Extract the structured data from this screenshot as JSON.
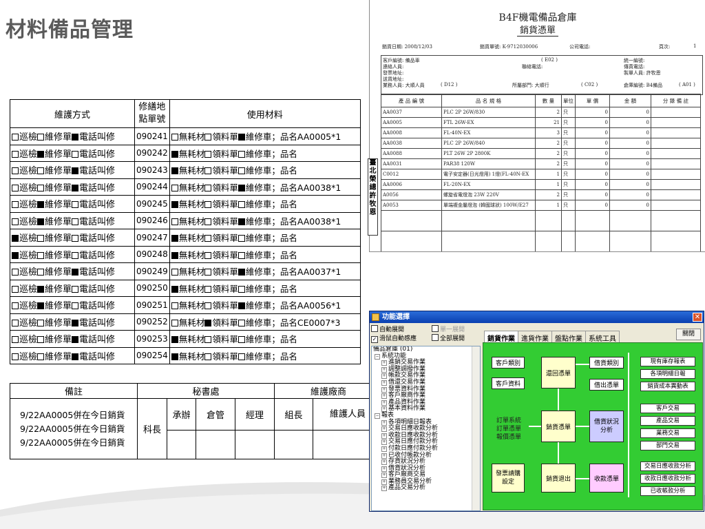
{
  "page": {
    "title": "材料備品管理"
  },
  "maintenance_table": {
    "headers": {
      "method": "維護方式",
      "order_no": "修繕地點單號",
      "materials": "使用材料"
    },
    "rows": [
      {
        "m": [
          0,
          0,
          1
        ],
        "no": "090241",
        "mat": [
          0,
          0,
          1
        ],
        "item": "品名AA0005*1"
      },
      {
        "m": [
          0,
          1,
          0
        ],
        "no": "090242",
        "mat": [
          1,
          0,
          0
        ],
        "item": "品名"
      },
      {
        "m": [
          0,
          0,
          1
        ],
        "no": "090243",
        "mat": [
          1,
          0,
          0
        ],
        "item": "品名"
      },
      {
        "m": [
          0,
          0,
          1
        ],
        "no": "090244",
        "mat": [
          0,
          0,
          1
        ],
        "item": "品名AA0038*1"
      },
      {
        "m": [
          0,
          1,
          0
        ],
        "no": "090245",
        "mat": [
          1,
          0,
          0
        ],
        "item": "品名"
      },
      {
        "m": [
          0,
          1,
          0
        ],
        "no": "090246",
        "mat": [
          0,
          0,
          1
        ],
        "item": "品名AA0038*1"
      },
      {
        "m": [
          1,
          0,
          0
        ],
        "no": "090247",
        "mat": [
          1,
          0,
          0
        ],
        "item": "品名"
      },
      {
        "m": [
          1,
          0,
          0
        ],
        "no": "090248",
        "mat": [
          1,
          0,
          0
        ],
        "item": "品名"
      },
      {
        "m": [
          0,
          0,
          1
        ],
        "no": "090249",
        "mat": [
          0,
          0,
          1
        ],
        "item": "品名AA0037*1"
      },
      {
        "m": [
          0,
          1,
          0
        ],
        "no": "090250",
        "mat": [
          1,
          0,
          0
        ],
        "item": "品名"
      },
      {
        "m": [
          0,
          1,
          0
        ],
        "no": "090251",
        "mat": [
          0,
          0,
          1
        ],
        "item": "品名AA0056*1"
      },
      {
        "m": [
          0,
          0,
          1
        ],
        "no": "090252",
        "mat": [
          0,
          1,
          0
        ],
        "item": "品名CE0007*3"
      },
      {
        "m": [
          0,
          0,
          1
        ],
        "no": "090253",
        "mat": [
          1,
          0,
          0
        ],
        "item": "品名"
      },
      {
        "m": [
          0,
          0,
          1
        ],
        "no": "090254",
        "mat": [
          1,
          0,
          0
        ],
        "item": "品名"
      }
    ],
    "method_labels": [
      "巡檢",
      "維修單",
      "電話叫修"
    ],
    "material_labels": [
      "無耗材",
      "領料單",
      "維修車；"
    ]
  },
  "footer_table": {
    "remark_header": "備註",
    "secretariat": "秘書處",
    "vendor": "維護廠商",
    "roles": [
      "科長",
      "承辦",
      "倉管",
      "經理",
      "組長",
      "維護人員"
    ],
    "remarks": [
      "9/22AA0005併在今日銷貨",
      "9/22AA0005併在今日銷貨",
      "9/22AA0005併在今日銷貨"
    ]
  },
  "invoice": {
    "title": "B4F機電備品倉庫",
    "subtitle": "銷貨憑單",
    "date": "銷貨日期: 2008/12/03",
    "no": "銷貨單號: K-9712030006",
    "phone": "公司電話:",
    "page": "頁次:",
    "page_num": "1",
    "customer": "客戶編號: 備品車",
    "customer_code": "( E02 )",
    "contact": "連絡人員:",
    "contact_phone": "聯絡電話:",
    "invoice_addr": "發票地址:",
    "ship_addr": "送貨地址:",
    "sales": "業務人員: 大順人員",
    "sales_code": "( D12 )",
    "dept": "所屬部門: 大順行",
    "dept_code": "( C02 )",
    "tax_id": "統一編號:",
    "fax": "傳真電話:",
    "maker": "製單人員: 許牧恩",
    "warehouse": "倉庫編號: B4備品",
    "warehouse_code": "( A01 )",
    "col_headers": [
      "產 品 編 號",
      "品 名 規 格",
      "數 量",
      "單位",
      "單 價",
      "金 額",
      "分 錄 備 註"
    ],
    "items": [
      {
        "code": "AA0037",
        "name": "PLC 2P 26W/830",
        "qty": "2",
        "unit": "只",
        "price": "0",
        "amount": "0"
      },
      {
        "code": "AA0005",
        "name": "FTL 26W-EX",
        "qty": "21",
        "unit": "只",
        "price": "0",
        "amount": "0"
      },
      {
        "code": "AA0008",
        "name": "FL-40N-EX",
        "qty": "3",
        "unit": "只",
        "price": "0",
        "amount": "0"
      },
      {
        "code": "AA0038",
        "name": "PLC 2P 26W/840",
        "qty": "2",
        "unit": "只",
        "price": "0",
        "amount": "0"
      },
      {
        "code": "AA0088",
        "name": "PLT 26W 2P 2800K",
        "qty": "2",
        "unit": "只",
        "price": "0",
        "amount": "0"
      },
      {
        "code": "AA0031",
        "name": "PAR38 120W",
        "qty": "2",
        "unit": "只",
        "price": "0",
        "amount": "0"
      },
      {
        "code": "C0012",
        "name": "電子安定器(日光燈用) 1燈(FL-40N-EX",
        "qty": "1",
        "unit": "只",
        "price": "0",
        "amount": "0"
      },
      {
        "code": "AA0006",
        "name": "FL-20N-EX",
        "qty": "1",
        "unit": "只",
        "price": "0",
        "amount": "0"
      },
      {
        "code": "A0056",
        "name": "螺旋省電燈泡 23W 220V",
        "qty": "2",
        "unit": "只",
        "price": "0",
        "amount": "0"
      },
      {
        "code": "A0053",
        "name": "單端複金屬燈泡 (韓國球狀) 100W/E27",
        "qty": "1",
        "unit": "只",
        "price": "0",
        "amount": "0"
      }
    ],
    "stamp": "臺北榮總許牧恩"
  },
  "app": {
    "title": "功能選擇",
    "opts": {
      "auto_expand": "自動展開",
      "single_expand": "單一展開",
      "mouse_sense": "滑鼠自動感應",
      "all_expand": "全部展開"
    },
    "tabs": [
      "銷貨作業",
      "進貨作業",
      "盤點作業",
      "系統工具"
    ],
    "close": "關閉",
    "tree": [
      {
        "t": "備品倉庫 (01)",
        "lvl": 0,
        "pm": ""
      },
      {
        "t": "系統功能",
        "lvl": 1,
        "pm": "−"
      },
      {
        "t": "進銷交易作業",
        "lvl": 2,
        "pm": "+"
      },
      {
        "t": "調整調撥作業",
        "lvl": 2,
        "pm": "+"
      },
      {
        "t": "帳款交易作業",
        "lvl": 2,
        "pm": "+"
      },
      {
        "t": "借還交易作業",
        "lvl": 2,
        "pm": "+"
      },
      {
        "t": "發票資料作業",
        "lvl": 2,
        "pm": "+"
      },
      {
        "t": "客戶廠商作業",
        "lvl": 2,
        "pm": "+"
      },
      {
        "t": "產品資料作業",
        "lvl": 2,
        "pm": "+"
      },
      {
        "t": "基本資料作業",
        "lvl": 2,
        "pm": "+"
      },
      {
        "t": "報表",
        "lvl": 1,
        "pm": "−"
      },
      {
        "t": "各項明細日報表",
        "lvl": 2,
        "pm": "+"
      },
      {
        "t": "交易日應收款分析",
        "lvl": 2,
        "pm": "+"
      },
      {
        "t": "收款日應收款分析",
        "lvl": 2,
        "pm": "+"
      },
      {
        "t": "交易日應付款分析",
        "lvl": 2,
        "pm": "+"
      },
      {
        "t": "付款日應付款分析",
        "lvl": 2,
        "pm": "+"
      },
      {
        "t": "已收付帳款分析",
        "lvl": 2,
        "pm": "+"
      },
      {
        "t": "存貨狀況分析",
        "lvl": 2,
        "pm": "+"
      },
      {
        "t": "借貨狀況分析",
        "lvl": 2,
        "pm": "+"
      },
      {
        "t": "客戶廠商交易",
        "lvl": 2,
        "pm": "+"
      },
      {
        "t": "業務員交易分析",
        "lvl": 2,
        "pm": "+"
      },
      {
        "t": "產品交易分析",
        "lvl": 2,
        "pm": "+"
      }
    ],
    "flow": {
      "cust_cat": "客戶類別",
      "cust_data": "客戶資料",
      "return_note": "還回憑單",
      "loan_cat": "借貨類別",
      "loan_note": "借出憑單",
      "order_text": "訂單系統\n訂單憑單\n報價憑單",
      "sales_note": "銷貨憑單",
      "loan_status": "借貨狀況\n分析",
      "invoice_setup": "發票請購\n設定",
      "sales_return": "銷貨退出",
      "receipt": "收款憑單"
    },
    "right_buttons": [
      "現有庫存報表",
      "各項明細日報",
      "銷貨成本異動表",
      "客戶交易",
      "產品交易",
      "業務交易",
      "部門交易",
      "交易日應收款分析",
      "收款日應收款分析",
      "已收帳款分析"
    ]
  }
}
